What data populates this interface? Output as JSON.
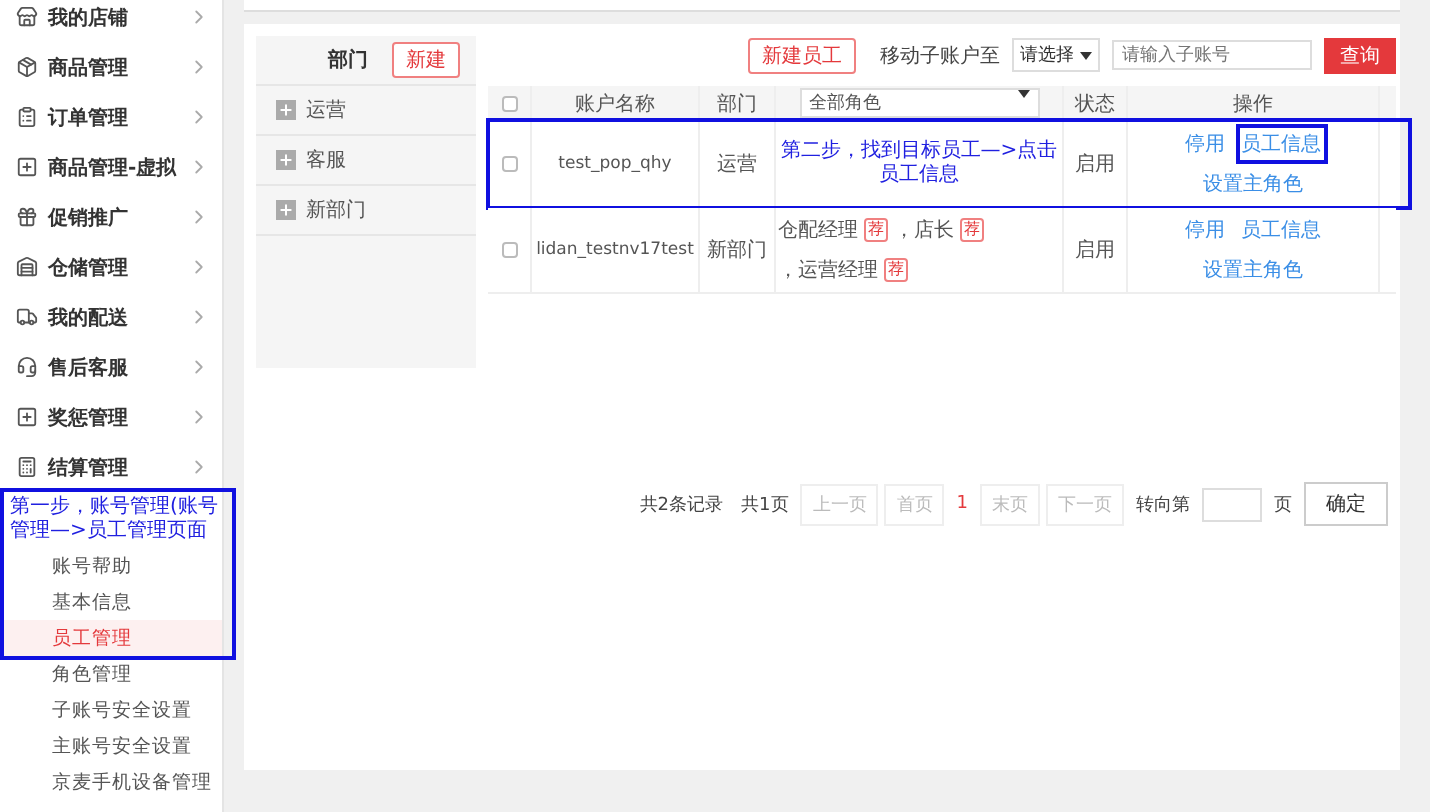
{
  "sidebar": {
    "items": [
      {
        "label": "我的店铺"
      },
      {
        "label": "商品管理"
      },
      {
        "label": "订单管理"
      },
      {
        "label": "商品管理-虚拟"
      },
      {
        "label": "促销推广"
      },
      {
        "label": "仓储管理"
      },
      {
        "label": "我的配送"
      },
      {
        "label": "售后客服"
      },
      {
        "label": "奖惩管理"
      },
      {
        "label": "结算管理"
      }
    ],
    "group": {
      "annotation": "第一步，账号管理(账号管理—>员工管理页面",
      "children": [
        {
          "label": "账号帮助",
          "selected": false
        },
        {
          "label": "基本信息",
          "selected": false
        },
        {
          "label": "员工管理",
          "selected": true
        },
        {
          "label": "角色管理",
          "selected": false
        },
        {
          "label": "子账号安全设置",
          "selected": false
        },
        {
          "label": "主账号安全设置",
          "selected": false
        },
        {
          "label": "京麦手机设备管理",
          "selected": false
        }
      ]
    }
  },
  "departments": {
    "title": "部门",
    "new_button": "新建",
    "items": [
      "运营",
      "客服",
      "新部门"
    ]
  },
  "toolbar": {
    "new_employee": "新建员工",
    "move_label": "移动子账户至",
    "select": "请选择",
    "search_placeholder": "请输入子账号",
    "query": "查询"
  },
  "table": {
    "all_checked": false,
    "columns": [
      "账户名称",
      "部门",
      "全部角色",
      "状态",
      "操作"
    ],
    "rows": [
      {
        "checked": false,
        "highlighted": true,
        "annotation": "第二步，找到目标员工—>点击员工信息",
        "name": "test_pop_qhy",
        "department": "运营",
        "roles": [],
        "status": "启用",
        "actions": [
          {
            "label": "停用",
            "highlighted": false
          },
          {
            "label": "员工信息",
            "highlighted": true
          },
          {
            "label": "设置主角色",
            "highlighted": false
          }
        ]
      },
      {
        "checked": false,
        "highlighted": false,
        "name": "lidan_testnv17test",
        "department": "新部门",
        "roles": [
          {
            "name": "仓配经理",
            "tag": "荐"
          },
          {
            "name": "，店长",
            "tag": "荐"
          },
          {
            "name": "，运营经理",
            "tag": "荐"
          }
        ],
        "status": "启用",
        "actions": [
          {
            "label": "停用",
            "highlighted": false
          },
          {
            "label": "员工信息",
            "highlighted": false
          },
          {
            "label": "设置主角色",
            "highlighted": false
          }
        ]
      }
    ]
  },
  "pagination": {
    "records": "共2条记录",
    "pages": "共1页",
    "prev": "上一页",
    "first": "首页",
    "current": "1",
    "last": "末页",
    "next": "下一页",
    "goto_label": "转向第",
    "page_unit": "页",
    "confirm": "确定"
  }
}
